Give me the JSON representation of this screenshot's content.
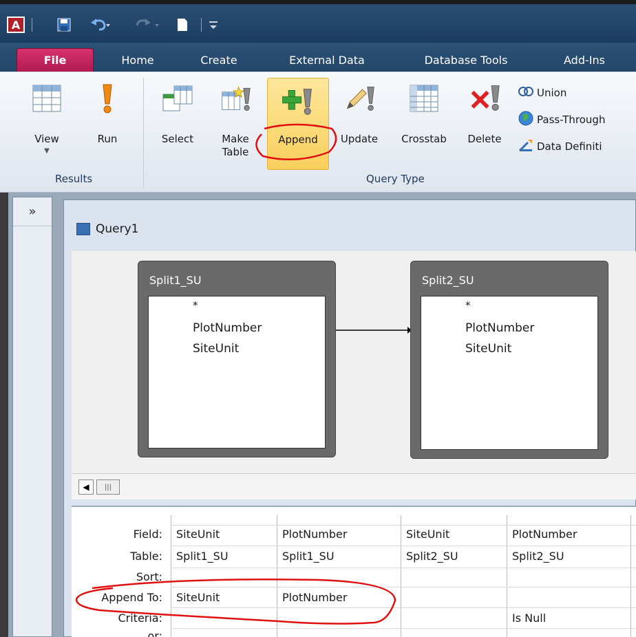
{
  "qat": {
    "app_icon_letter": "A",
    "save_icon": "save-icon",
    "undo_icon": "undo-icon",
    "redo_icon": "redo-icon",
    "new_icon": "new-document-icon",
    "customize_icon": "customize-qat-icon"
  },
  "tabs": [
    "File",
    "Home",
    "Create",
    "External Data",
    "Database Tools",
    "Add-Ins"
  ],
  "ribbon": {
    "results_group": "Results",
    "query_type_group": "Query Type",
    "buttons": {
      "view": "View",
      "run": "Run",
      "select": "Select",
      "make_table_1": "Make",
      "make_table_2": "Table",
      "append": "Append",
      "update": "Update",
      "crosstab": "Crosstab",
      "delete": "Delete"
    },
    "small": {
      "union": "Union",
      "pass_through": "Pass-Through",
      "data_definition": "Data Definiti"
    }
  },
  "nav": {
    "toggle": "»"
  },
  "query": {
    "title": "Query1",
    "tables": [
      {
        "name": "Split1_SU",
        "fields": [
          "*",
          "PlotNumber",
          "SiteUnit"
        ]
      },
      {
        "name": "Split2_SU",
        "fields": [
          "*",
          "PlotNumber",
          "SiteUnit"
        ]
      }
    ]
  },
  "grid": {
    "row_labels": [
      "Field:",
      "Table:",
      "Sort:",
      "Append To:",
      "Criteria:",
      "or:"
    ],
    "columns": [
      {
        "field": "SiteUnit",
        "table": "Split1_SU",
        "append_to": "SiteUnit",
        "criteria": ""
      },
      {
        "field": "PlotNumber",
        "table": "Split1_SU",
        "append_to": "PlotNumber",
        "criteria": ""
      },
      {
        "field": "SiteUnit",
        "table": "Split2_SU",
        "append_to": "",
        "criteria": ""
      },
      {
        "field": "PlotNumber",
        "table": "Split2_SU",
        "append_to": "",
        "criteria": "Is Null"
      }
    ]
  },
  "colors": {
    "annotation": "#e01010",
    "file_tab": "#c2255c",
    "append_highlight": "#f9cf5c"
  }
}
